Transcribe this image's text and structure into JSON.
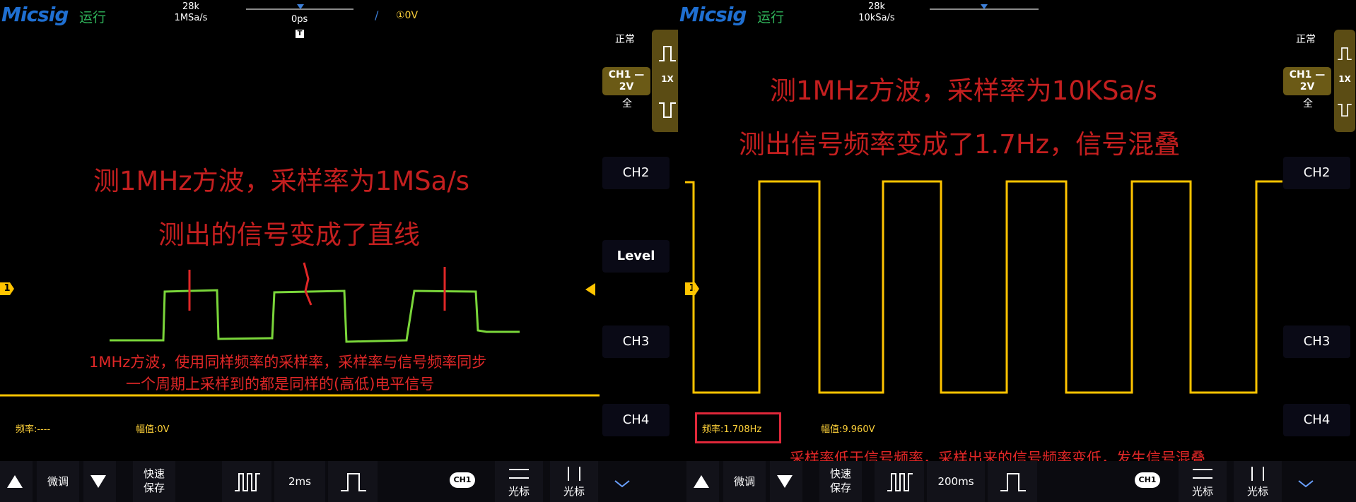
{
  "left": {
    "logo": "Micsig",
    "run_state": "运行",
    "points": "28k",
    "sample_rate": "1MSa/s",
    "time_offset": "0ps",
    "trigger_flag": "T",
    "trigger_slash": "/",
    "trigger_level": "①0V",
    "trigger_mode": "正常",
    "ch1_label": "CH1",
    "ch1_scale": "2V",
    "coupling": "全",
    "probe": "1X",
    "ch2": "CH2",
    "level": "Level",
    "ch3": "CH3",
    "ch4": "CH4",
    "ch1_marker": "1",
    "annotation_title_1": "测1MHz方波，采样率为1MSa/s",
    "annotation_title_2": "测出的信号变成了直线",
    "annotation_note_1": "1MHz方波，使用同样频率的采样率，采样率与信号频率同步",
    "annotation_note_2": "一个周期上采样到的都是同样的(高低)电平信号",
    "freq_meas": "频率:----",
    "amp_meas": "幅值:0V",
    "fine_tune": "微调",
    "quick_save_1": "快速",
    "quick_save_2": "保存",
    "timebase": "2ms",
    "cursor_1": "光标",
    "cursor_2": "光标",
    "ch1_menu": "CH1"
  },
  "right": {
    "logo": "Micsig",
    "run_state": "运行",
    "points": "28k",
    "sample_rate": "10kSa/s",
    "trigger_mode": "正常",
    "ch1_label": "CH1",
    "ch1_scale": "2V",
    "coupling": "全",
    "probe": "1X",
    "ch2": "CH2",
    "ch3": "CH3",
    "ch4": "CH4",
    "ch1_marker": "1",
    "annotation_title_1": "测1MHz方波，采样率为10KSa/s",
    "annotation_title_2": "测出信号频率变成了1.7Hz，信号混叠",
    "annotation_note": "采样率低于信号频率，采样出来的信号频率变低，发生信号混叠",
    "freq_meas": "频率:1.708Hz",
    "amp_meas": "幅值:9.960V",
    "fine_tune": "微调",
    "quick_save_1": "快速",
    "quick_save_2": "保存",
    "timebase": "200ms",
    "cursor_1": "光标",
    "cursor_2": "光标",
    "ch1_menu": "CH1"
  },
  "colors": {
    "trace_yellow": "#ffc400",
    "sketch_green": "#7ad63a",
    "annotation_red": "#e02727",
    "logo_blue": "#1f6fd1",
    "run_green": "#2fb35a",
    "trigger_panel": "#5b4c14"
  },
  "icons": [
    "pulse-icon",
    "arrow-up-icon",
    "arrow-down-icon",
    "chevron-down-icon",
    "trigger-marker-icon"
  ]
}
